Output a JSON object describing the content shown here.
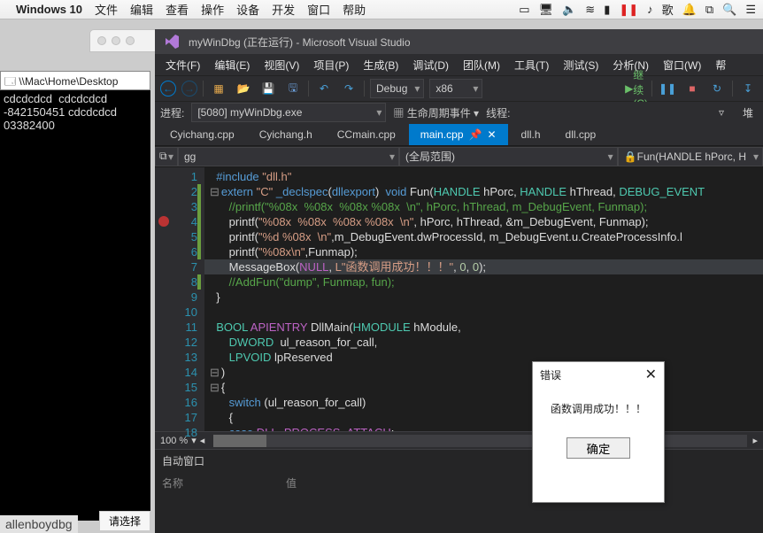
{
  "macmenu": {
    "app": "Windows 10",
    "items": [
      "文件",
      "编辑",
      "查看",
      "操作",
      "设备",
      "开发",
      "窗口",
      "帮助"
    ],
    "right_icons": [
      "message-icon",
      "display-icon",
      "volume-icon",
      "wifi-icon",
      "battery-icon",
      "pause-icon",
      "note-icon",
      "ime-icon",
      "bell-icon",
      "dock-icon",
      "search-icon",
      "menu-icon"
    ]
  },
  "console": {
    "title": "\\\\Mac\\Home\\Desktop",
    "lines": [
      "cdcdcdcd  cdcdcdcd",
      "-842150451 cdcdcdcd",
      "03382400"
    ]
  },
  "host_label": "allenboydbg",
  "small_button": "请选择",
  "vs": {
    "title": "myWinDbg (正在运行) - Microsoft Visual Studio",
    "menus": [
      "文件(F)",
      "编辑(E)",
      "视图(V)",
      "项目(P)",
      "生成(B)",
      "调试(D)",
      "团队(M)",
      "工具(T)",
      "测试(S)",
      "分析(N)",
      "窗口(W)",
      "帮"
    ],
    "toolbar": {
      "config": "Debug",
      "platform": "x86",
      "continue": "继续(C)"
    },
    "process": {
      "label": "进程:",
      "value": "[5080] myWinDbg.exe",
      "lifecycle": "生命周期事件",
      "thread": "线程:"
    },
    "tabs": [
      "Cyichang.cpp",
      "Cyichang.h",
      "CCmain.cpp",
      "main.cpp",
      "dll.h",
      "dll.cpp"
    ],
    "active_tab": 3,
    "nav": {
      "left_icon": "scope-icon",
      "left": "gg",
      "middle": "(全局范围)",
      "right": "Fun(HANDLE hPorc, H"
    },
    "code": {
      "lines": [
        {
          "n": 1,
          "html": "<span class='kw'>#include</span> <span class='str'>\"dll.h\"</span>"
        },
        {
          "n": 2,
          "fold": "⊟",
          "chg": true,
          "html": "<span class='kw'>extern</span> <span class='str'>\"C\"</span> <span class='kw'>_declspec</span>(<span class='kw'>dllexport</span>)  <span class='kw'>void</span> <span class='fn'>Fun</span>(<span class='typ'>HANDLE</span> hPorc, <span class='typ'>HANDLE</span> hThread, <span class='typ'>DEBUG_EVENT</span>"
        },
        {
          "n": 3,
          "chg": true,
          "html": "    <span class='cm'>//printf(\"%08x  %08x  %08x %08x  \\n\", hPorc, hThread, m_DebugEvent, Funmap);</span>"
        },
        {
          "n": 4,
          "bp": true,
          "chg": true,
          "html": "    <span class='fn'>printf</span>(<span class='str'>\"%08x  %08x  %08x %08x  \\n\"</span>, hPorc, hThread, &m_DebugEvent, Funmap);"
        },
        {
          "n": 5,
          "chg": true,
          "html": "    <span class='fn'>printf</span>(<span class='str'>\"%d %08x  \\n\"</span>,m_DebugEvent.<span class='fn'>dwProcessId</span>, m_DebugEvent.<span class='fn'>u</span>.<span class='fn'>CreateProcessInfo</span>.l"
        },
        {
          "n": 6,
          "chg": true,
          "html": "    <span class='fn'>printf</span>(<span class='str'>\"%08x\\n\"</span>,Funmap);"
        },
        {
          "n": 7,
          "hl": true,
          "html": "    <span class='fn'>MessageBox</span>(<span class='mac'>NULL</span>, <span class='str'>L\"函数调用成功！！！\"</span>, <span class='num'>0</span>, <span class='num'>0</span>);"
        },
        {
          "n": 8,
          "chg": true,
          "html": "    <span class='cm'>//AddFun(\"dump\", Funmap, fun);</span>"
        },
        {
          "n": 9,
          "html": "}"
        },
        {
          "n": 10,
          "html": ""
        },
        {
          "n": 11,
          "html": "<span class='typ'>BOOL</span> <span class='mac'>APIENTRY</span> <span class='fn'>DllMain</span>(<span class='typ'>HMODULE</span> hModule,"
        },
        {
          "n": 12,
          "html": "    <span class='typ'>DWORD</span>  ul_reason_for_call,"
        },
        {
          "n": 13,
          "html": "    <span class='typ'>LPVOID</span> lpReserved"
        },
        {
          "n": 14,
          "fold": "⊟",
          "html": ")"
        },
        {
          "n": 15,
          "fold": "⊟",
          "html": "{"
        },
        {
          "n": 16,
          "html": "    <span class='kw'>switch</span> (ul_reason_for_call)"
        },
        {
          "n": 17,
          "html": "    {"
        },
        {
          "n": 18,
          "html": "    <span class='kw'>case</span> <span class='mac'>DLL_PROCESS_ATTACH</span>:"
        }
      ]
    },
    "zoom": "100 %",
    "panel": {
      "title": "自动窗口",
      "col1": "名称",
      "col2": "值"
    }
  },
  "msgbox": {
    "title": "错误",
    "body": "函数调用成功！！！",
    "ok": "确定"
  }
}
